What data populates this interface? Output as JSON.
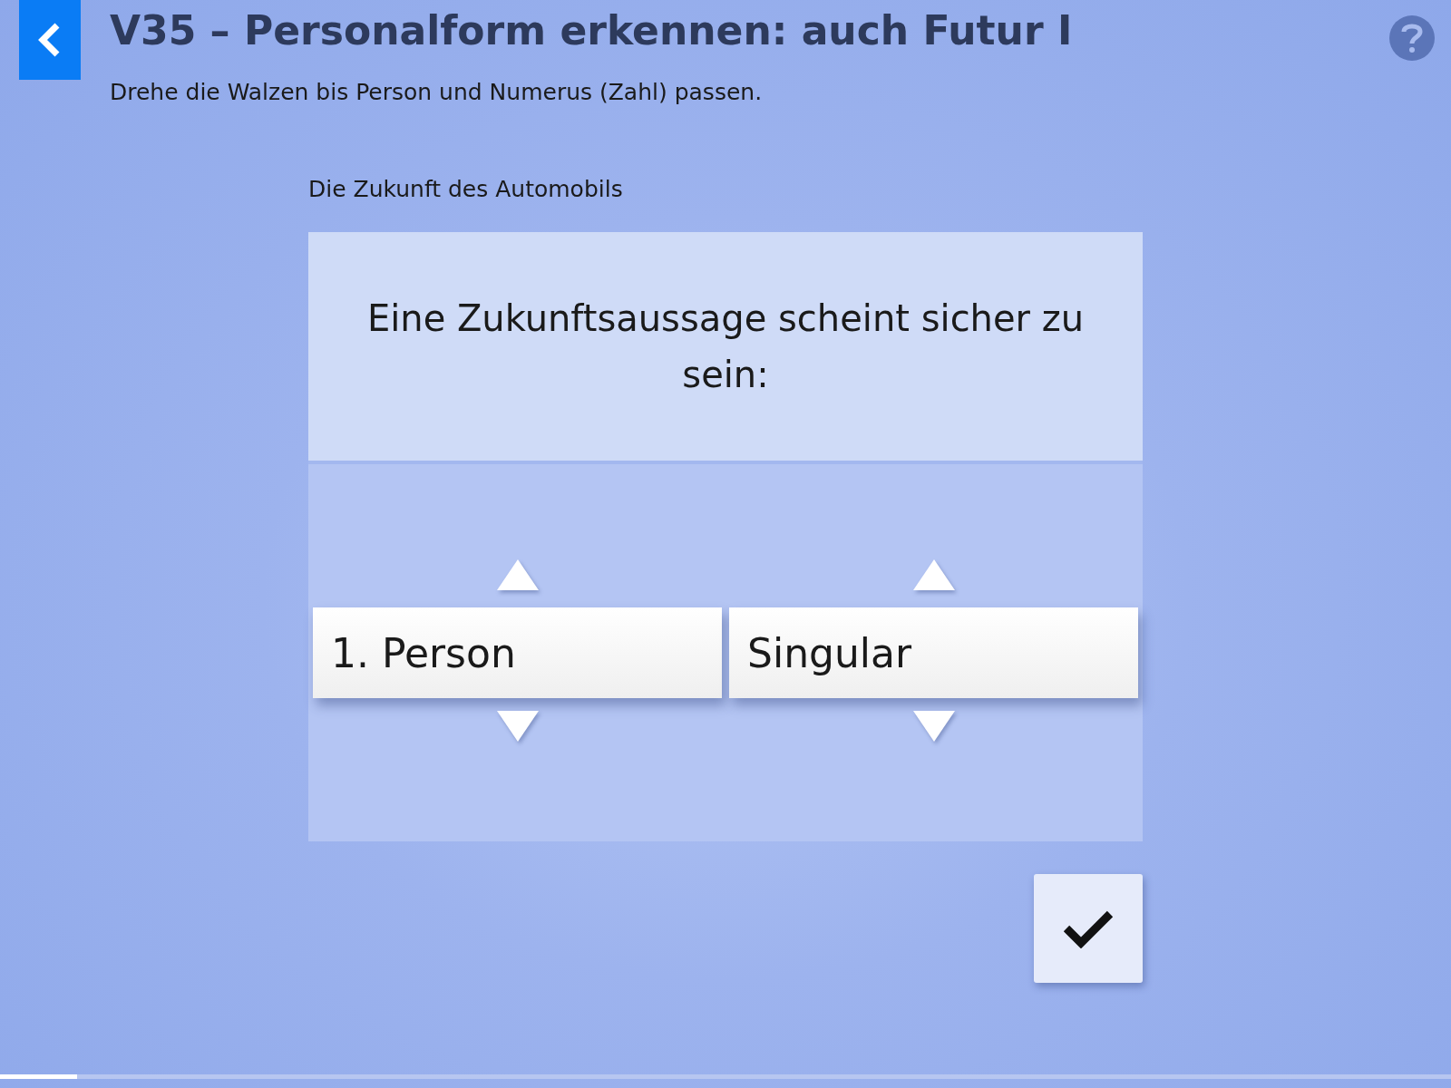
{
  "header": {
    "title": "V35 – Personalform erkennen: auch Futur I",
    "instruction": "Drehe die Walzen bis Person und Numerus (Zahl) passen."
  },
  "task": {
    "context": "Die Zukunft des Automobils",
    "question": "Eine Zukunftsaussage scheint sicher zu sein:"
  },
  "wheels": [
    {
      "value": "1. Person"
    },
    {
      "value": "Singular"
    }
  ],
  "progress": {
    "level": 0.053
  }
}
